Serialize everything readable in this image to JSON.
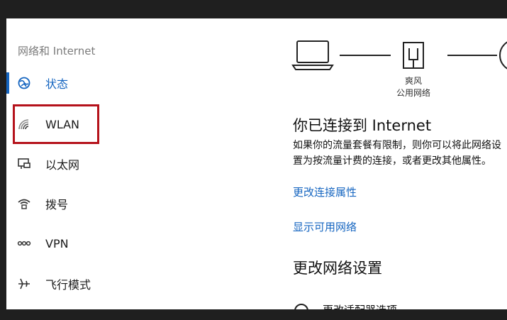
{
  "sidebar": {
    "heading": "网络和 Internet",
    "items": [
      {
        "label": "状态",
        "icon": "home-globe-icon",
        "active": true
      },
      {
        "label": "WLAN",
        "icon": "wifi-icon",
        "active": false
      },
      {
        "label": "以太网",
        "icon": "ethernet-icon",
        "active": false
      },
      {
        "label": "拨号",
        "icon": "dialup-icon",
        "active": false
      },
      {
        "label": "VPN",
        "icon": "vpn-icon",
        "active": false
      },
      {
        "label": "飞行模式",
        "icon": "airplane-icon",
        "active": false
      }
    ]
  },
  "diagram": {
    "router_name": "爽风",
    "router_network_type": "公用网络"
  },
  "status": {
    "title": "你已连接到 Internet",
    "description": "如果你的流量套餐有限制，则你可以将此网络设置为按流量计费的连接，或者更改其他属性。"
  },
  "links": {
    "change_connection_properties": "更改连接属性",
    "show_available_networks": "显示可用网络"
  },
  "settings": {
    "title": "更改网络设置",
    "first_item": "更改适配器选项"
  },
  "colors": {
    "accent": "#1565c0",
    "highlight": "#b5121b",
    "background": "#ffffff",
    "frame": "#1f1f1f"
  }
}
